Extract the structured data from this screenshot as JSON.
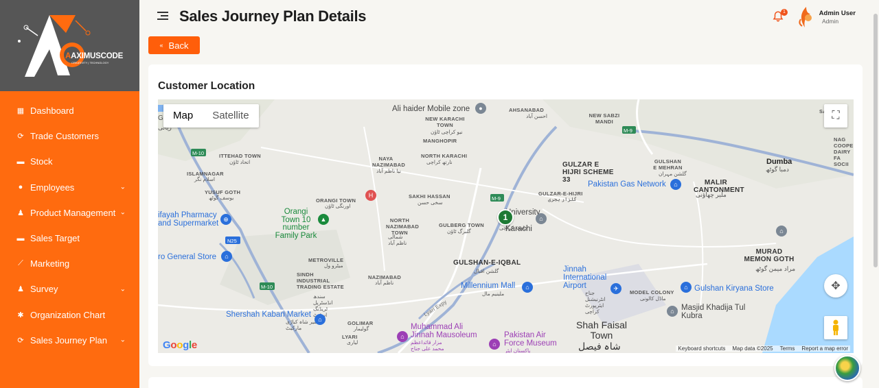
{
  "brand": {
    "logo_text": "AXIMUSCODE",
    "logo_tagline": "CREATIVITY | TECHNOLOGY"
  },
  "sidebar": {
    "items": [
      {
        "label": "Dashboard",
        "icon": "grid-icon",
        "has_submenu": false
      },
      {
        "label": "Trade Customers",
        "icon": "refresh-icon",
        "has_submenu": false
      },
      {
        "label": "Stock",
        "icon": "box-icon",
        "has_submenu": false
      },
      {
        "label": "Employees",
        "icon": "user-icon",
        "has_submenu": true
      },
      {
        "label": "Product Management",
        "icon": "users-icon",
        "has_submenu": true
      },
      {
        "label": "Sales Target",
        "icon": "box-icon",
        "has_submenu": false
      },
      {
        "label": "Marketing",
        "icon": "chart-icon",
        "has_submenu": false
      },
      {
        "label": "Survey",
        "icon": "users-icon",
        "has_submenu": true
      },
      {
        "label": "Organization Chart",
        "icon": "gear-icon",
        "has_submenu": false
      },
      {
        "label": "Sales Journey Plan",
        "icon": "refresh-icon",
        "has_submenu": true
      }
    ]
  },
  "header": {
    "title": "Sales Journey Plan Details",
    "notification_count": "1",
    "user_name": "Admin User",
    "user_role": "Admin"
  },
  "back_button": {
    "label": "Back"
  },
  "card": {
    "title": "Customer Location"
  },
  "map": {
    "type_options": [
      "Map",
      "Satellite"
    ],
    "selected_type": "Map",
    "cluster_count": "1",
    "google_label": "Google",
    "attribution": [
      "Keyboard shortcuts",
      "Map data ©2025",
      "Terms",
      "Report a map error"
    ],
    "labels": {
      "ali_haider": "Ali haider Mobile zone",
      "ahsanabad": "AHSANABAD",
      "ahsanabad_ur": "احسن آباد",
      "new_sabzi_mandi": "NEW SABZI MANDI",
      "new_karachi_town": "NEW KARACHI TOWN",
      "new_karachi_town_ur": "نیو کراچی ٹاؤن",
      "manghopir": "MANGHOPIR",
      "ittehad_town": "ITTEHAD TOWN",
      "ittehad_town_ur": "اتحاد ٹاؤن",
      "islamnagar": "ISLAMNAGAR",
      "islamnagar_ur": "اسلام نگر",
      "naya_nazimabad": "NAYA NAZIMABAD",
      "naya_nazimabad_ur": "نیا ناظم آباد",
      "north_karachi": "NORTH KARACHI",
      "north_karachi_ur": "نارتھ کراچی",
      "gulzar_e_hijri_33": "GULZAR E HIJRI SCHEME 33",
      "gulshan_e_mehran": "GULSHAN E MEHRAN",
      "gulshan_e_mehran_ur": "گلشن مہران",
      "dumba": "Dumba",
      "dumba_ur": "دمبا گوٹھ",
      "malir_cantonment": "MALIR CANTONMENT",
      "malir_cantonment_ur": "ملیر چھاؤنی",
      "yusuf_goth": "YUSUF GOTH",
      "yusuf_goth_ur": "یوسف گوٹھ",
      "orangi_town": "ORANGI TOWN",
      "orangi_town_ur": "اورنگی ٹاؤن",
      "sakhi_hassan": "SAKHI HASSAN",
      "sakhi_hassan_ur": "سخی حسن",
      "gulzar_e_hijri": "GULZAR-E-HIJRI",
      "gulzar_e_hijri_ur": "گلزار ہجری",
      "pakistan_gas": "Pakistan Gas Network",
      "pharmacy": "ifayah Pharmacy and Supermarket",
      "orangi_10": "Orangi Town 10 number Family Park",
      "north_nazimabad": "NORTH NAZIMABAD TOWN",
      "north_nazimabad_ur": "شمالی ناظم آباد",
      "gulberg_town": "GULBERG TOWN",
      "gulberg_town_ur": "گلبرگ ٹاؤن",
      "university": "University of Karachi",
      "university_ur": "جامعہ کراچی",
      "general_store": "ro General Store",
      "metroville": "METROVILLE",
      "metroville_ur": "میٹرو ول",
      "gulshan_e_iqbal": "GULSHAN-E-IQBAL",
      "gulshan_e_iqbal_ur": "گلشن اقبال",
      "murad_memon": "MURAD MEMON GOTH",
      "murad_memon_ur": "مراد میمن گوٹھ",
      "sindh_industrial": "SINDH INDUSTRIAL TRADING ESTATE",
      "sindh_industrial_ur": "سندھ انڈسٹریل ٹریڈنگ اسٹیٹ",
      "nazimabad": "NAZIMABAD",
      "nazimabad_ur": "ناظم آباد",
      "millennium_mall": "Millennium Mall",
      "millennium_mall_ur": "ملینیم مال",
      "jinnah_airport": "Jinnah International Airport",
      "jinnah_airport_ur": "جناح انٹرنیشنل ایئرپورٹ کراچی",
      "model_colony": "MODEL COLONY",
      "model_colony_ur": "ماڈل کالونی",
      "gulshan_kiryana": "Gulshan Kiryana Store",
      "shershah": "Shershah Kabari Market",
      "shershah_ur": "شیر شاہ کباڑی مارکیٹ",
      "golimar": "GOLIMAR",
      "golimar_ur": "گولیمار",
      "lyari": "LYARI",
      "lyari_ur": "لیاری",
      "mausoleum": "Muhammad Ali Jinnah Mausoleum",
      "mausoleum_ur": "مزار قائداعظم محمد علی جناح",
      "paf_museum": "Pakistan Air Force Museum",
      "paf_museum_ur": "پاکستان ایئر",
      "shah_faisal": "Shah Faisal Town",
      "shah_faisal_ur": "شاہ فیصل",
      "masjid": "Masjid Khadija Tul Kubra",
      "m10": "M-10",
      "m9": "M-9",
      "n25": "N25",
      "lyari_expy": "Lyari Expy",
      "sajj": "SAJJ",
      "nag": "NAG COOPER DAIRY FA SOCII",
      "riyali": "ریالی",
      "g_edge": "G"
    }
  }
}
